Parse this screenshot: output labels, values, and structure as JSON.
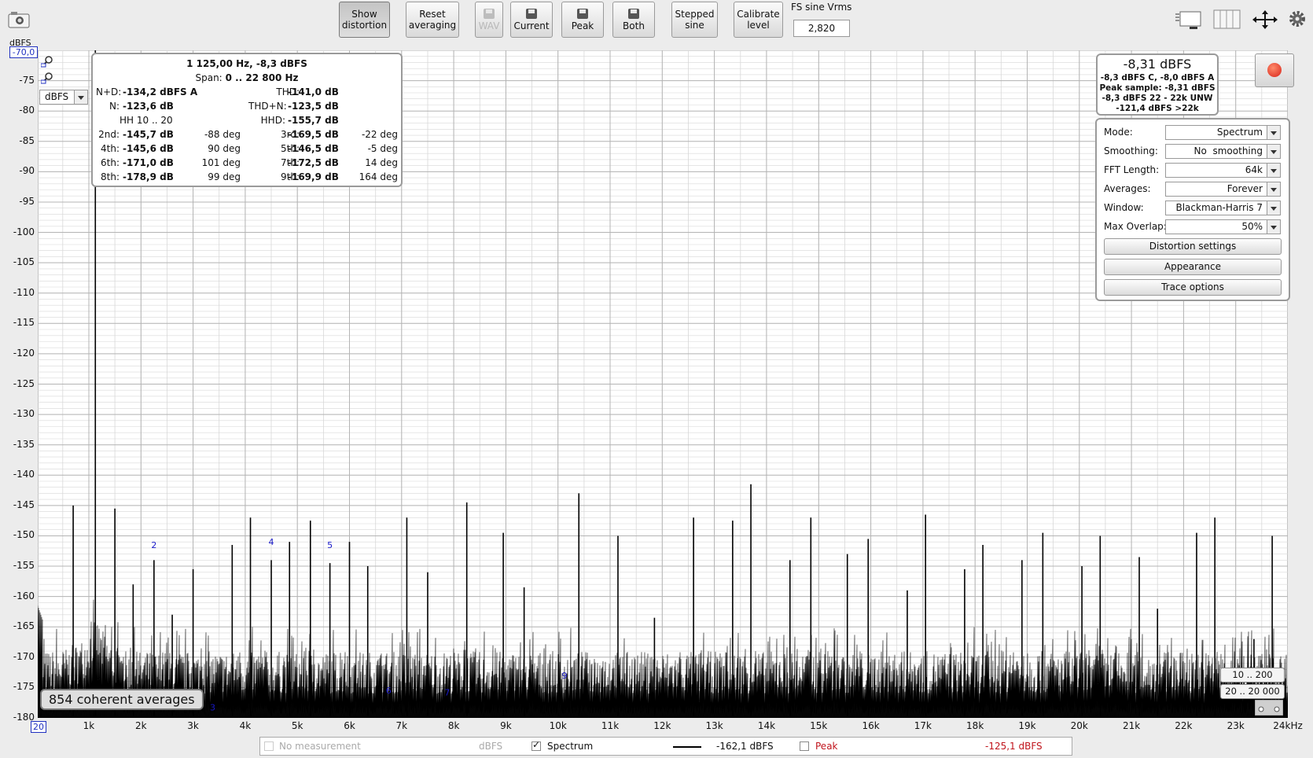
{
  "toolbar": {
    "show_distortion": "Show\ndistortion",
    "reset_averaging": "Reset\naveraging",
    "wav": "WAV",
    "current": "Current",
    "peak": "Peak",
    "both": "Both",
    "stepped_sine": "Stepped\nsine",
    "calibrate_level": "Calibrate\nlevel",
    "fs_sine_label": "FS sine Vrms",
    "fs_sine_value": "2,820"
  },
  "axis": {
    "y_unit": "dBFS",
    "y_top_value": "-70,0",
    "y_ticks": [
      "-75",
      "-80",
      "-85",
      "-90",
      "-95",
      "-100",
      "-105",
      "-110",
      "-115",
      "-120",
      "-125",
      "-130",
      "-135",
      "-140",
      "-145",
      "-150",
      "-155",
      "-160",
      "-165",
      "-170",
      "-175",
      "-180"
    ],
    "x_start": "20",
    "x_ticks": [
      "1k",
      "2k",
      "3k",
      "4k",
      "5k",
      "6k",
      "7k",
      "8k",
      "9k",
      "10k",
      "11k",
      "12k",
      "13k",
      "14k",
      "15k",
      "16k",
      "17k",
      "18k",
      "19k",
      "20k",
      "21k",
      "22k",
      "23k",
      "24kHz"
    ],
    "unit_select": "dBFS"
  },
  "distortion": {
    "header": "1 125,00 Hz, -8,3 dBFS",
    "span_label": "Span:",
    "span_value": "0 .. 22 800 Hz",
    "nd_label": "N+D:",
    "nd_value": "-134,2 dBFS A",
    "thd_label": "THD:",
    "thd_value": "-141,0 dB",
    "n_label": "N:",
    "n_value": "-123,6 dB",
    "thdn_label": "THD+N:",
    "thdn_value": "-123,5 dB",
    "hh_label": "HH 10 .. 20",
    "hhd_label": "HHD:",
    "hhd_value": "-155,7 dB",
    "harmonics": [
      {
        "l1": "2nd:",
        "v1": "-145,7 dB",
        "d1": "-88 deg",
        "l2": "3rd:",
        "v2": "-169,5 dB",
        "d2": "-22 deg"
      },
      {
        "l1": "4th:",
        "v1": "-145,6 dB",
        "d1": "90 deg",
        "l2": "5th:",
        "v2": "-146,5 dB",
        "d2": "-5 deg"
      },
      {
        "l1": "6th:",
        "v1": "-171,0 dB",
        "d1": "101 deg",
        "l2": "7th:",
        "v2": "-172,5 dB",
        "d2": "14 deg"
      },
      {
        "l1": "8th:",
        "v1": "-178,9 dB",
        "d1": "99 deg",
        "l2": "9th:",
        "v2": "-169,9 dB",
        "d2": "164 deg"
      }
    ]
  },
  "level": {
    "main": "-8,31 dBFS",
    "line1": "-8,3 dBFS C, -8,0 dBFS A",
    "line2": "Peak sample: -8,31 dBFS",
    "line3": "-8,3 dBFS 22 - 22k UNW",
    "line4": "-121,4 dBFS >22k"
  },
  "settings": {
    "mode_label": "Mode:",
    "mode_value": "Spectrum",
    "smoothing_label": "Smoothing:",
    "smoothing_value": "No  smoothing",
    "fft_label": "FFT Length:",
    "fft_value": "64k",
    "averages_label": "Averages:",
    "averages_value": "Forever",
    "window_label": "Window:",
    "window_value": "Blackman-Harris 7",
    "overlap_label": "Max Overlap:",
    "overlap_value": "50%",
    "distortion_settings": "Distortion settings",
    "appearance": "Appearance",
    "trace_options": "Trace options"
  },
  "averages_badge": "854 coherent averages",
  "range_buttons": {
    "r1": "10 .. 200",
    "r2": "20 .. 20 000"
  },
  "harmonic_markers": [
    "2",
    "4",
    "5",
    "3",
    "6",
    "7",
    "9"
  ],
  "legend": {
    "no_measurement": "No measurement",
    "no_measurement_unit": "dBFS",
    "spectrum": "Spectrum",
    "spectrum_value": "-162,1 dBFS",
    "peak": "Peak",
    "peak_value": "-125,1 dBFS"
  },
  "colors": {
    "peak_text": "#c0141c",
    "marker_blue": "#1818c8",
    "record_red": "#e03018"
  },
  "chart_data": {
    "type": "line",
    "xlabel": "",
    "ylabel": "dBFS",
    "xlim": [
      20,
      24000
    ],
    "ylim": [
      -180,
      -70
    ],
    "series": [
      {
        "name": "Spectrum"
      }
    ],
    "peaks": [
      {
        "x": 700,
        "y": -145
      },
      {
        "x": 1125,
        "y": -8.3
      },
      {
        "x": 1500,
        "y": -145.5
      },
      {
        "x": 1850,
        "y": -158
      },
      {
        "x": 2250,
        "y": -154
      },
      {
        "x": 2600,
        "y": -163
      },
      {
        "x": 3000,
        "y": -155.5
      },
      {
        "x": 3750,
        "y": -151.5
      },
      {
        "x": 4100,
        "y": -147
      },
      {
        "x": 4500,
        "y": -154
      },
      {
        "x": 4850,
        "y": -151
      },
      {
        "x": 5250,
        "y": -147.5
      },
      {
        "x": 5625,
        "y": -154.5
      },
      {
        "x": 6000,
        "y": -151
      },
      {
        "x": 6350,
        "y": -155
      },
      {
        "x": 7100,
        "y": -147
      },
      {
        "x": 7500,
        "y": -156
      },
      {
        "x": 8250,
        "y": -144.5
      },
      {
        "x": 8950,
        "y": -149.5
      },
      {
        "x": 9350,
        "y": -158.5
      },
      {
        "x": 10400,
        "y": -143
      },
      {
        "x": 11150,
        "y": -150
      },
      {
        "x": 11850,
        "y": -163.5
      },
      {
        "x": 12600,
        "y": -147
      },
      {
        "x": 13350,
        "y": -147.5
      },
      {
        "x": 13700,
        "y": -141.5
      },
      {
        "x": 14450,
        "y": -154
      },
      {
        "x": 14850,
        "y": -147
      },
      {
        "x": 15550,
        "y": -153
      },
      {
        "x": 15950,
        "y": -150.5
      },
      {
        "x": 16700,
        "y": -159
      },
      {
        "x": 17050,
        "y": -146.5
      },
      {
        "x": 17800,
        "y": -155.5
      },
      {
        "x": 18150,
        "y": -151.5
      },
      {
        "x": 18900,
        "y": -154
      },
      {
        "x": 19300,
        "y": -149.5
      },
      {
        "x": 20050,
        "y": -155
      },
      {
        "x": 20400,
        "y": -150
      },
      {
        "x": 21150,
        "y": -153.5
      },
      {
        "x": 21500,
        "y": -162
      },
      {
        "x": 22250,
        "y": -149.5
      },
      {
        "x": 22600,
        "y": -147
      },
      {
        "x": 23350,
        "y": -167
      },
      {
        "x": 23700,
        "y": -150
      }
    ]
  }
}
